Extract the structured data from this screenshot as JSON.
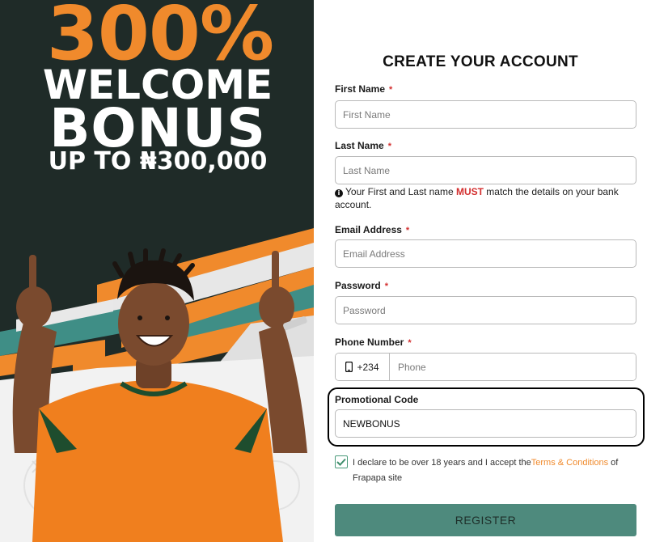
{
  "promo": {
    "percent": "300%",
    "line1": "WELCOME",
    "line2": "BONUS",
    "line3": "UP TO ₦300,000"
  },
  "form": {
    "title": "CREATE YOUR ACCOUNT",
    "required_mark": "*",
    "first_name": {
      "label": "First Name",
      "placeholder": "First Name",
      "value": ""
    },
    "last_name": {
      "label": "Last Name",
      "placeholder": "Last Name",
      "value": ""
    },
    "name_note": {
      "before": "Your First and Last name ",
      "emphasis": "MUST",
      "after": " match the details on your bank account."
    },
    "email": {
      "label": "Email Address",
      "placeholder": "Email Address",
      "value": ""
    },
    "password": {
      "label": "Password",
      "placeholder": "Password",
      "value": ""
    },
    "phone": {
      "label": "Phone Number",
      "country_code": "+234",
      "placeholder": "Phone",
      "value": ""
    },
    "promo_code": {
      "label": "Promotional Code",
      "value": "NEWBONUS"
    },
    "declaration": {
      "checked": true,
      "text_before": "I declare to be over 18 years and I accept the",
      "link_text": "Terms & Conditions",
      "text_after": " of Frapapa site"
    },
    "register_label": "REGISTER"
  },
  "colors": {
    "accent_orange": "#f08a2c",
    "panel_dark": "#1f2b28",
    "button_green": "#4e8a7d",
    "required_red": "#d32f2f"
  },
  "icons": {
    "info": "info-circle-icon",
    "phone": "mobile-phone-icon",
    "check": "checkmark-icon"
  }
}
